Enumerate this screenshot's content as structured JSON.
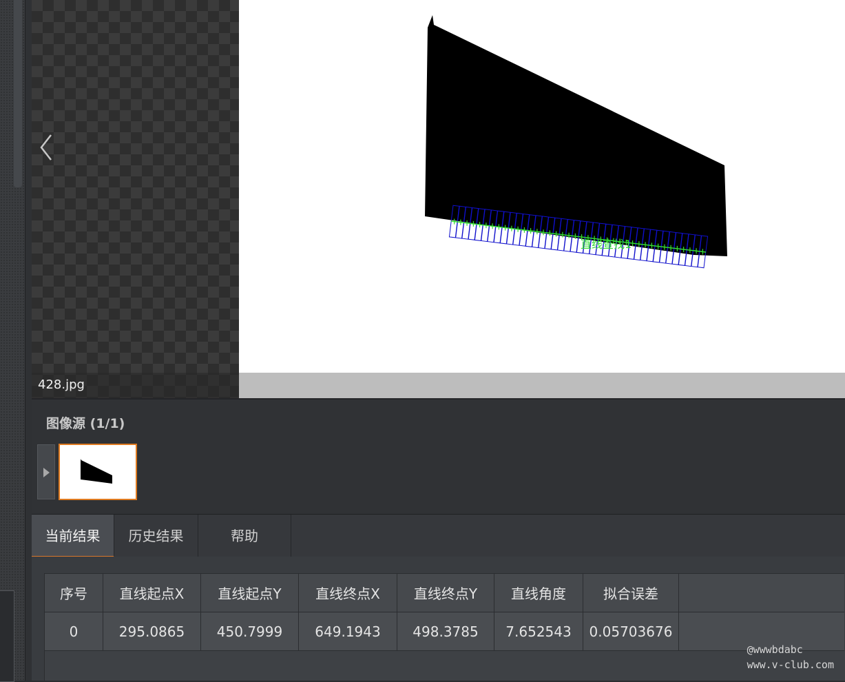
{
  "viewer": {
    "file_name": "428.jpg",
    "prev_icon": "chevron-left-icon",
    "overlay_label": "直线查找1"
  },
  "source_panel": {
    "title": "图像源 (1/1)",
    "expand_icon": "triangle-right-icon",
    "accent_color": "#e07b20"
  },
  "tabs": [
    {
      "label": "当前结果",
      "active": true
    },
    {
      "label": "历史结果",
      "active": false
    },
    {
      "label": "帮助",
      "active": false
    }
  ],
  "results_table": {
    "headers": [
      "序号",
      "直线起点X",
      "直线起点Y",
      "直线终点X",
      "直线终点Y",
      "直线角度",
      "拟合误差"
    ],
    "rows": [
      [
        "0",
        "295.0865",
        "450.7999",
        "649.1943",
        "498.3785",
        "7.652543",
        "0.05703676"
      ]
    ]
  },
  "watermark": {
    "line1": "@wwwbdabc",
    "line2": "www.v-club.com"
  },
  "colors": {
    "caliper_box": "#1010cc",
    "fit_line": "#33dd33",
    "tab_accent": "#d9772a"
  }
}
